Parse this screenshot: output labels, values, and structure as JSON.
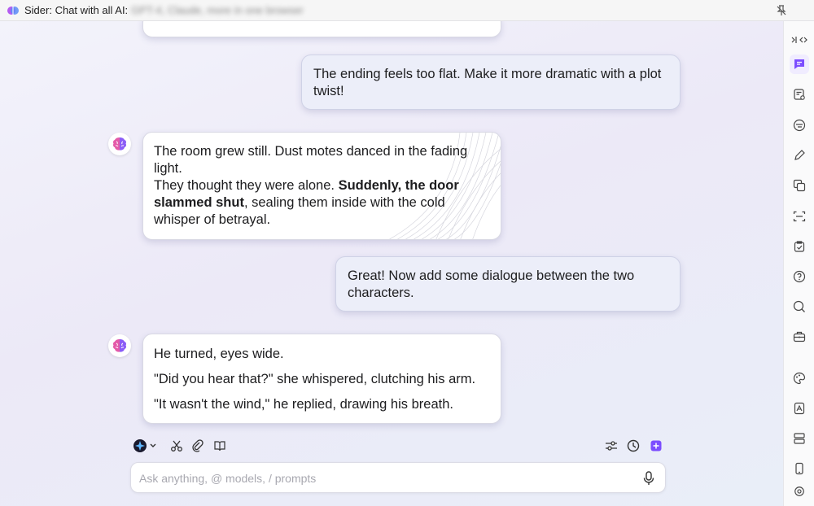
{
  "window": {
    "title": "Sider: Chat with all AI:",
    "title_obscured": "GPT-4, Claude, more in one browser"
  },
  "messages": [
    {
      "role": "user",
      "text": "The ending feels too flat. Make it more dramatic with a plot twist!"
    },
    {
      "role": "assistant",
      "line1": "The room grew still. Dust motes danced in the fading light.",
      "line2_pre": "They thought they were alone. ",
      "line2_bold": "Suddenly, the door slammed shut",
      "line2_post": ", sealing them inside with the cold whisper of betrayal."
    },
    {
      "role": "user",
      "text": "Great! Now add some dialogue between the two characters."
    },
    {
      "role": "assistant",
      "paragraphs": [
        "He turned, eyes wide.",
        "\"Did you hear that?\" she whispered, clutching his arm.",
        "\"It wasn't the wind,\" he replied, drawing his breath."
      ]
    }
  ],
  "composer": {
    "placeholder": "Ask anything, @ models, / prompts",
    "value": ""
  },
  "colors": {
    "accent": "#7c4dff",
    "bubble_user": "#eceef9",
    "bubble_assistant": "#ffffff"
  },
  "toolbar_icons": [
    "model-selector-icon",
    "scissors-icon",
    "attach-icon",
    "book-icon",
    "settings-sliders-icon",
    "history-icon",
    "new-chat-icon"
  ],
  "sidebar_icons": [
    "collapse-icon",
    "chat-icon",
    "file-chat-icon",
    "translate-icon",
    "write-icon",
    "image-icon",
    "scan-icon",
    "checklist-icon",
    "help-icon",
    "search-icon",
    "toolbox-icon",
    "palette-icon",
    "pdf-icon",
    "layout-icon",
    "phone-icon",
    "target-icon"
  ]
}
